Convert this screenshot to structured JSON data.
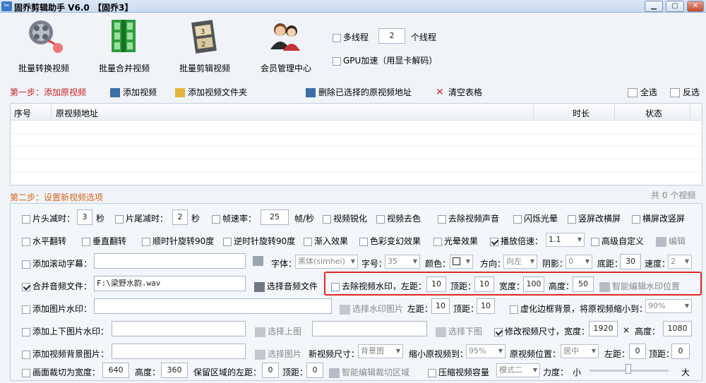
{
  "window": {
    "title": "固乔剪辑助手 V6.0",
    "tag": "【固乔3】"
  },
  "toolbar": {
    "big_buttons": [
      "批量转换视频",
      "批量合并视频",
      "批量剪辑视频",
      "会员管理中心"
    ],
    "multithread_label": "多线程",
    "thread_count": "2",
    "thread_unit": "个线程",
    "gpu_label": "GPU加速（用显卡解码）"
  },
  "step1": {
    "label": "第一步：添加原视频",
    "add_video": "添加视频",
    "add_folder": "添加视频文件夹",
    "delete_selected": "删除已选择的原视频地址",
    "clear_table": "清空表格",
    "select_all": "全选",
    "invert": "反选"
  },
  "table": {
    "col_index": "序号",
    "col_path": "原视频地址",
    "col_duration": "时长",
    "col_status": "状态"
  },
  "step2": {
    "label": "第二步：设置新视频选项",
    "count": "共 0 个视频"
  },
  "row1": {
    "head_cut": "片头减时：",
    "head_val": "3",
    "sec1": "秒",
    "tail_cut": "片尾减时：",
    "tail_val": "2",
    "sec2": "秒",
    "fps": "帧速率：",
    "fps_val": "25",
    "fps_unit": "帧/秒",
    "sharpen": "视频锐化",
    "decolor": "视频去色",
    "mute": "去除视频声音",
    "flash": "闪烁光晕",
    "v2h": "竖屏改横屏",
    "h2v": "横屏改竖屏"
  },
  "row2": {
    "hflip": "水平翻转",
    "vflip": "垂直翻转",
    "rot90": "顺时针旋转90度",
    "crot90": "逆时针旋转90度",
    "fadein": "渐入效果",
    "colorfx": "色彩变幻效果",
    "halo": "光晕效果",
    "speed": "播放倍速：",
    "speed_val": "1.1",
    "advanced": "高级自定义",
    "edit": "编辑"
  },
  "row3": {
    "scroll_sub": "添加滚动字幕：",
    "font_label": "字体：",
    "font_val": "黑体(simhei)",
    "size_label": "字号：",
    "size_val": "35",
    "color_label": "颜色：",
    "dir_label": "方向：",
    "dir_val": "向左",
    "shadow_label": "阴影：",
    "shadow_val": "0",
    "bottom_label": "底距：",
    "bottom_val": "30",
    "speed_label": "速度：",
    "speed_val": "2"
  },
  "row4": {
    "merge_audio": "合并音频文件：",
    "audio_path": "F:\\梁野水韵.wav",
    "choose_audio": "选择音频文件",
    "remove_wm": "去除视频水印，左距：",
    "left_val": "10",
    "top_label": "顶距：",
    "top_val": "10",
    "width_label": "宽度：",
    "width_val": "100",
    "height_label": "高度：",
    "height_val": "50",
    "smart_edit": "智能编辑水印位置"
  },
  "row5": {
    "img_wm": "添加图片水印：",
    "choose_wm": "选择水印图片",
    "left_label": "左距：",
    "left_val": "10",
    "top_label": "顶距：",
    "top_val": "10",
    "blur_bg": "虚化边框背景，将原视频缩小到：",
    "scale_val": "90%"
  },
  "row6": {
    "updown_wm": "添加上下图片水印：",
    "choose_up": "选择上图",
    "choose_down": "选择下图",
    "resize": "修改视频尺寸，宽度：",
    "w_val": "1920",
    "times": "×",
    "h_label": "高度：",
    "h_val": "1080"
  },
  "row7": {
    "bg_img": "添加视频背景图片：",
    "choose_img": "选择图片",
    "new_size": "新视频尺寸：",
    "new_size_val": "背景图",
    "shrink": "缩小原视频到：",
    "shrink_val": "95%",
    "pos": "原视频位置：",
    "pos_val": "居中",
    "left_label": "左距：",
    "left_val": "0",
    "top_label": "顶距：",
    "top_val": "0"
  },
  "row8": {
    "crop": "画面裁切为宽度：",
    "crop_w": "640",
    "h_label": "高度：",
    "crop_h": "360",
    "keep_left": "保留区域的左距：",
    "left_val": "0",
    "top_label": "顶距：",
    "top_val": "0",
    "smart_crop": "智能编辑裁切区域",
    "compress": "压缩视频容量",
    "mode_val": "模式二",
    "strength": "力度：",
    "small": "小",
    "large": "大"
  }
}
